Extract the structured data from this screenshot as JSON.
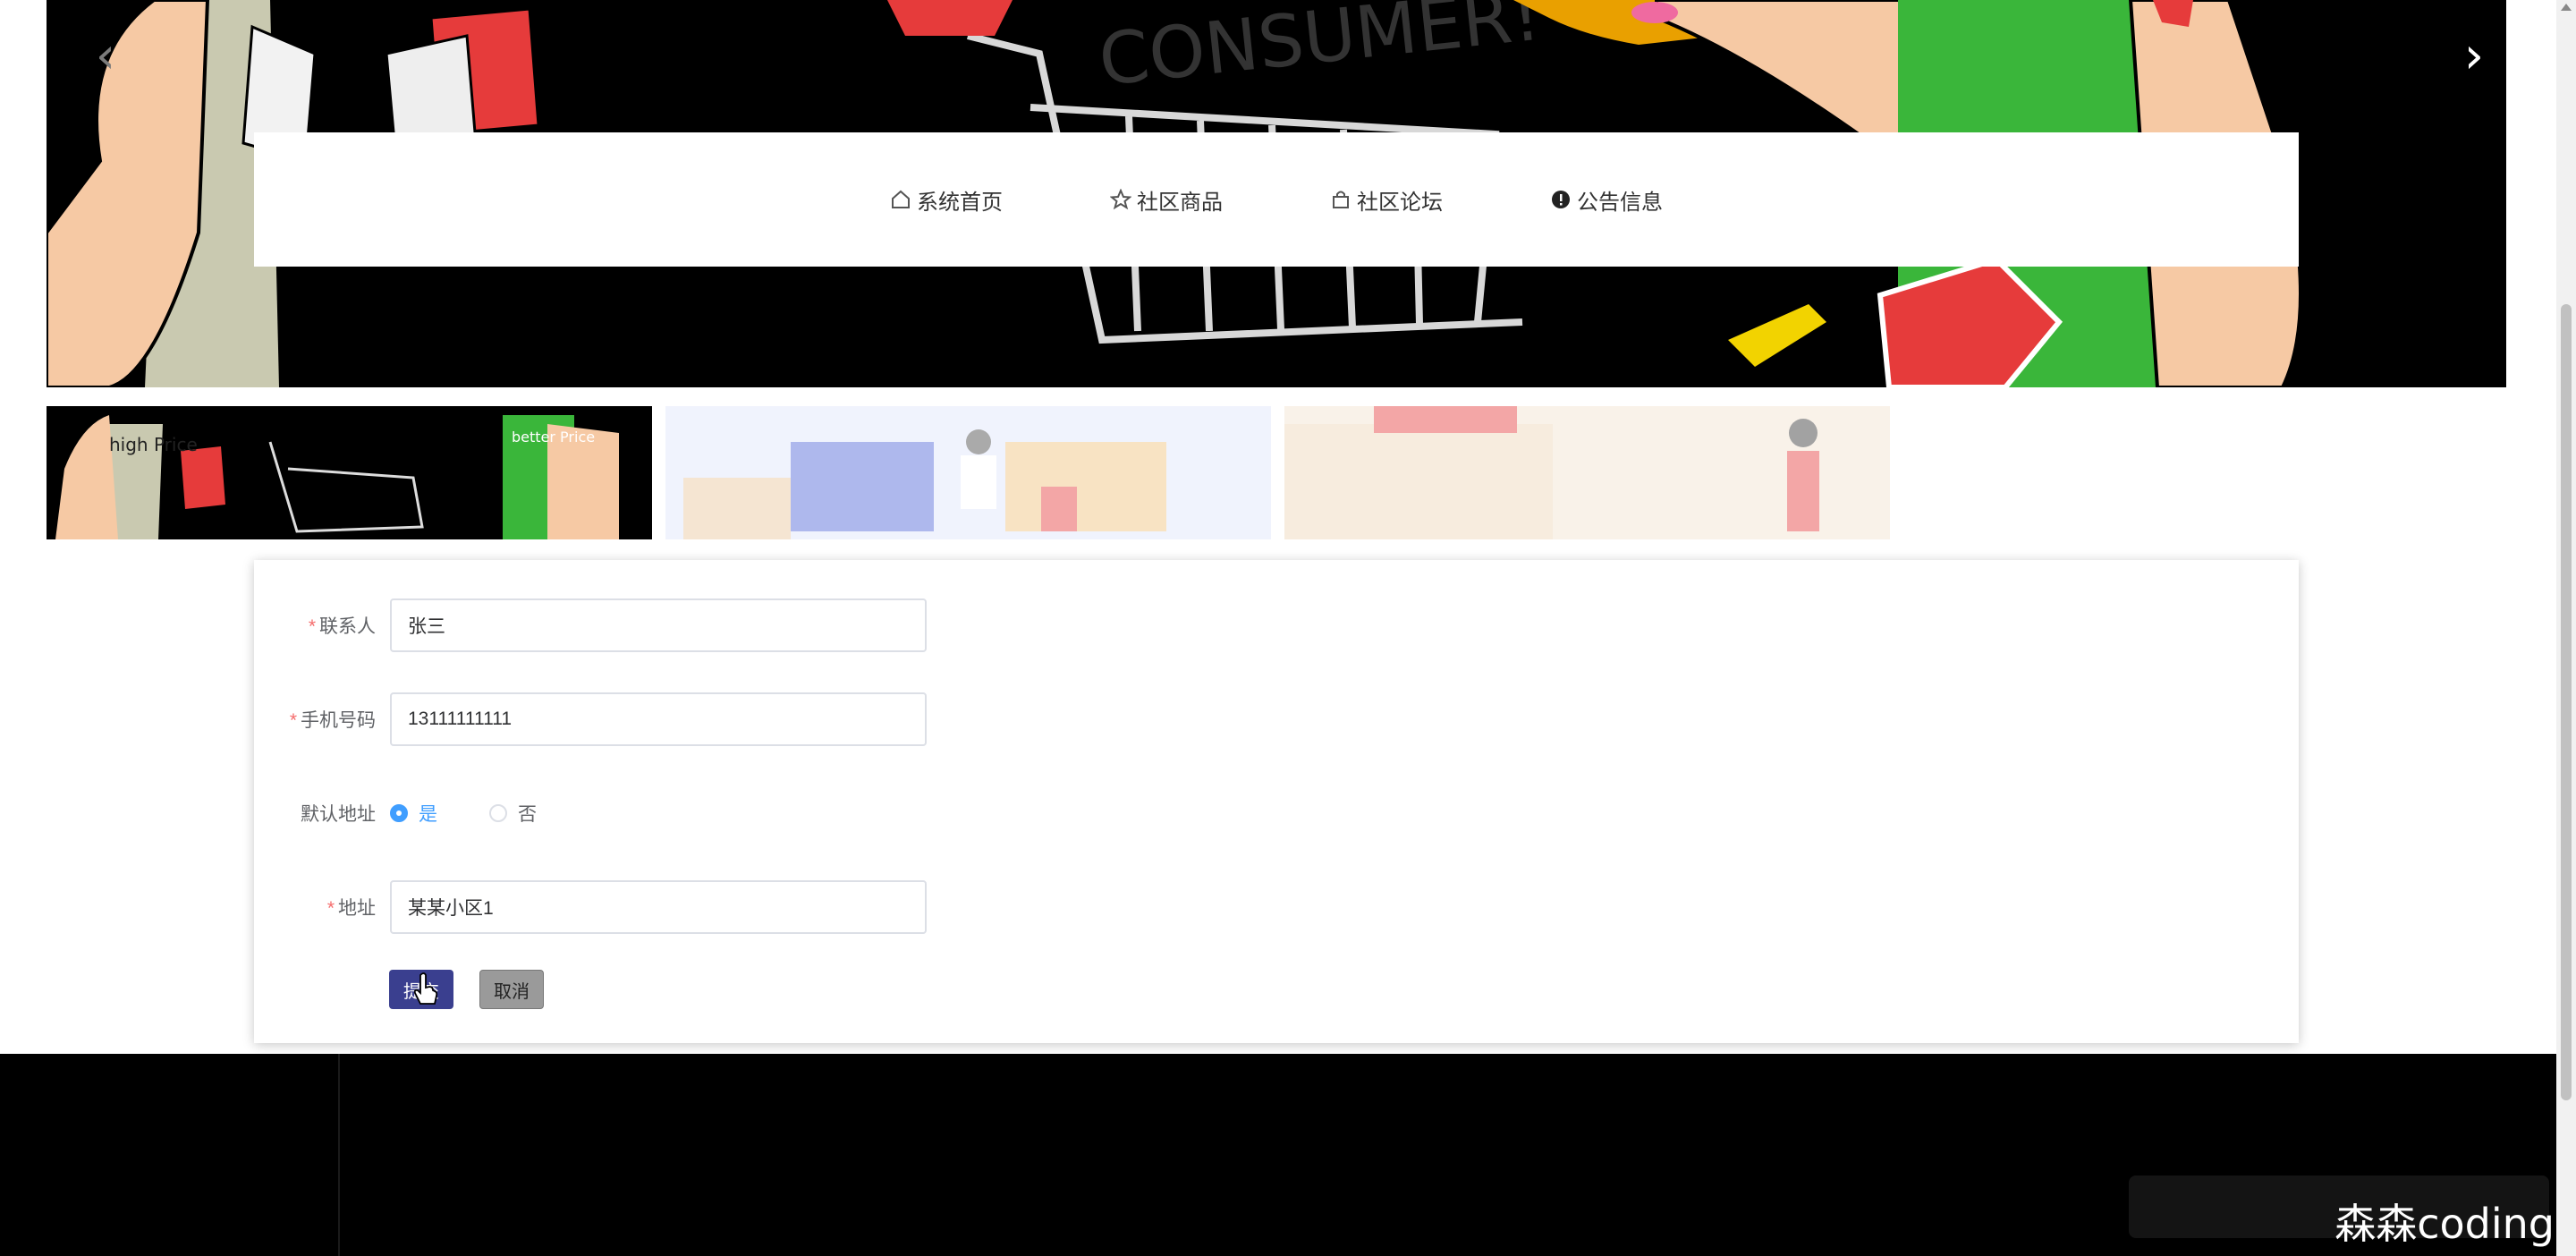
{
  "carousel": {
    "prev_icon": "chevron-left-icon",
    "next_icon": "chevron-right-icon",
    "prev_glyph": "‹",
    "next_glyph": "›",
    "banner_text": "CONSUMER!"
  },
  "nav": {
    "items": [
      {
        "label": "系统首页",
        "icon": "home-icon"
      },
      {
        "label": "社区商品",
        "icon": "star-icon"
      },
      {
        "label": "社区论坛",
        "icon": "bag-icon"
      },
      {
        "label": "公告信息",
        "icon": "exclamation-circle-icon"
      }
    ]
  },
  "thumbnails": {
    "t1_text_a": "high Price",
    "t1_text_b": "better Price"
  },
  "form": {
    "contact": {
      "label": "联系人",
      "value": "张三",
      "required": true
    },
    "phone": {
      "label": "手机号码",
      "value": "13111111111",
      "required": true
    },
    "default_address": {
      "label": "默认地址",
      "options": [
        "是",
        "否"
      ],
      "selected": "是"
    },
    "address": {
      "label": "地址",
      "value": "某某小区1",
      "required": true
    },
    "required_mark": "*",
    "submit_label": "提交",
    "cancel_label": "取消"
  },
  "footer": {
    "watermark": "森森coding"
  },
  "colors": {
    "primary": "#409eff",
    "submit_button": "#3a3f8f",
    "cancel_button": "#9a9a9a",
    "required": "#f56c6c"
  }
}
